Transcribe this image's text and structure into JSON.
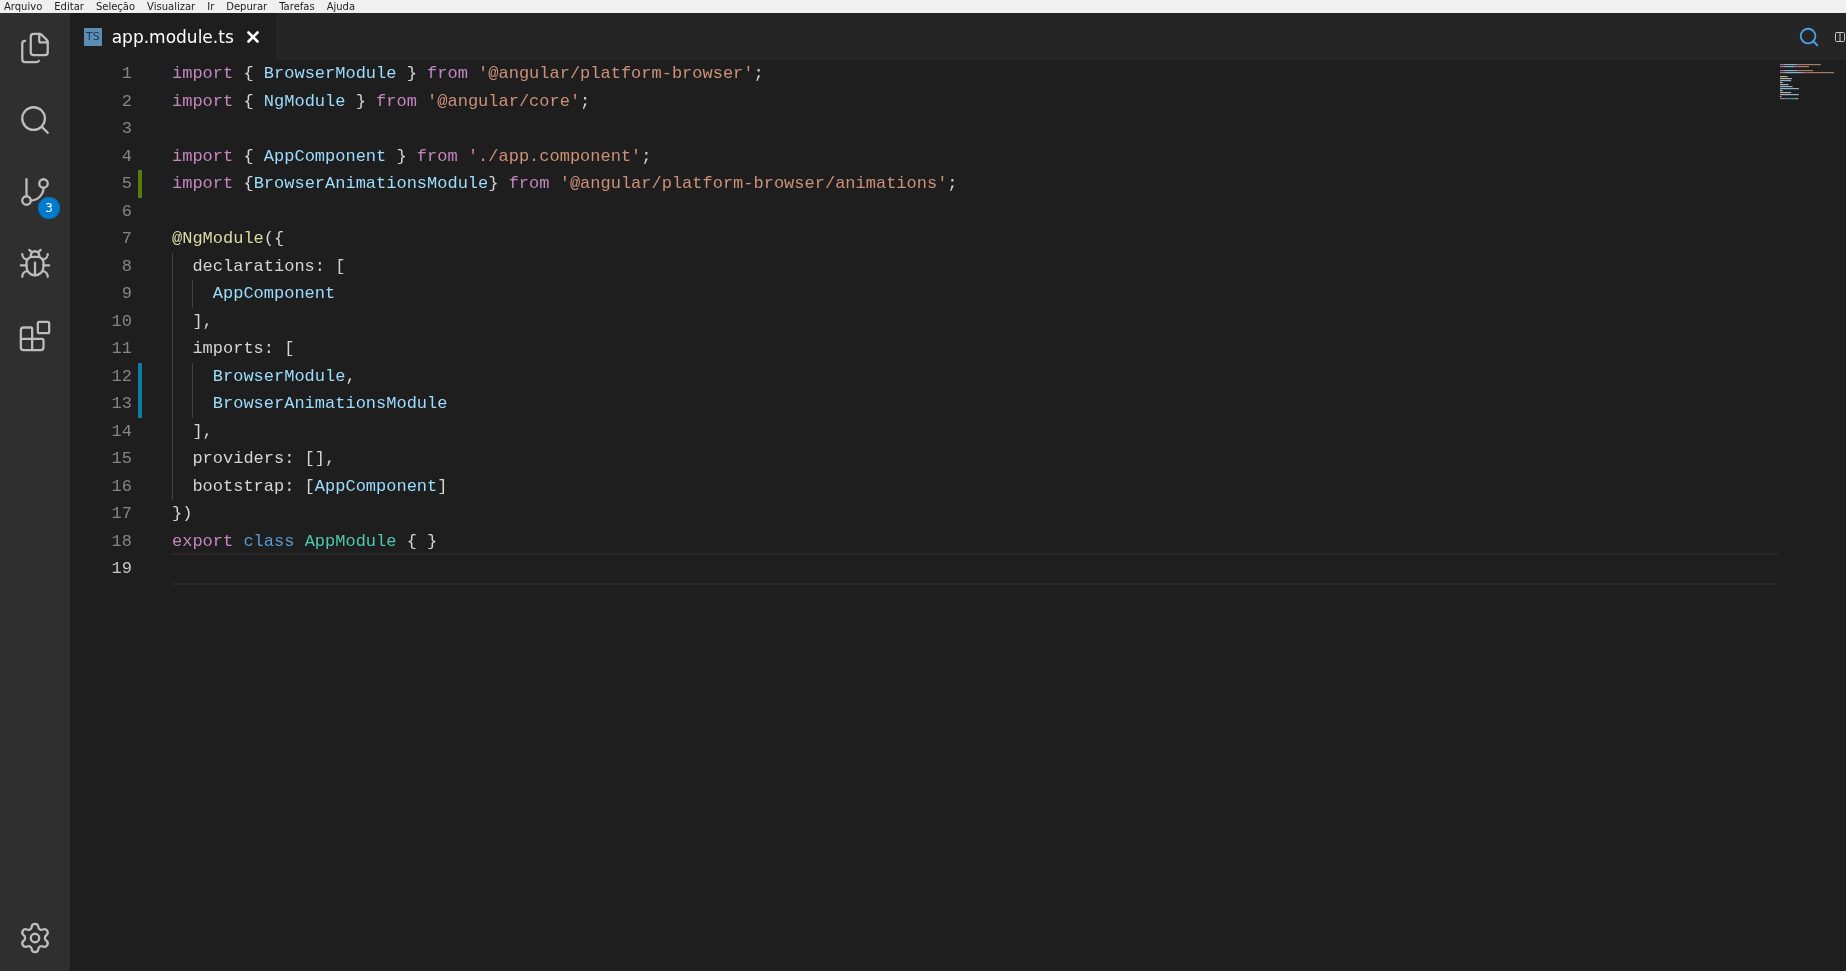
{
  "menu": [
    "Arquivo",
    "Editar",
    "Seleção",
    "Visualizar",
    "Ir",
    "Depurar",
    "Tarefas",
    "Ajuda"
  ],
  "activity_bar": {
    "items": [
      {
        "kind": "files",
        "selected": false
      },
      {
        "kind": "search",
        "selected": false
      },
      {
        "kind": "scm",
        "selected": false,
        "badge": "3"
      },
      {
        "kind": "debug",
        "selected": false
      },
      {
        "kind": "extensions",
        "selected": false
      }
    ],
    "settings": {
      "kind": "settings"
    }
  },
  "tabs": [
    {
      "label": "app.module.ts",
      "icon_text": "TS",
      "selected": true
    }
  ],
  "editor": {
    "lines": [
      {
        "number": "1",
        "added": false,
        "modified": false,
        "current": false,
        "tokens": [
          {
            "kind": "keyword",
            "s": "import"
          },
          {
            "kind": "plain",
            "s": " { "
          },
          {
            "kind": "var",
            "s": "BrowserModule"
          },
          {
            "kind": "plain",
            "s": " } "
          },
          {
            "kind": "keyword",
            "s": "from "
          },
          {
            "kind": "string",
            "s": "'@angular/platform-browser'"
          },
          {
            "kind": "plain",
            "s": ";"
          }
        ]
      },
      {
        "number": "2",
        "added": false,
        "modified": false,
        "current": false,
        "tokens": [
          {
            "kind": "keyword",
            "s": "import"
          },
          {
            "kind": "plain",
            "s": " { "
          },
          {
            "kind": "var",
            "s": "NgModule"
          },
          {
            "kind": "plain",
            "s": " } "
          },
          {
            "kind": "keyword",
            "s": "from "
          },
          {
            "kind": "string",
            "s": "'@angular/core'"
          },
          {
            "kind": "plain",
            "s": ";"
          }
        ]
      },
      {
        "number": "3",
        "added": false,
        "modified": false,
        "current": false
      },
      {
        "number": "4",
        "added": false,
        "modified": false,
        "current": false,
        "tokens": [
          {
            "kind": "keyword",
            "s": "import"
          },
          {
            "kind": "plain",
            "s": " { "
          },
          {
            "kind": "var",
            "s": "AppComponent"
          },
          {
            "kind": "plain",
            "s": " } "
          },
          {
            "kind": "keyword",
            "s": "from "
          },
          {
            "kind": "string",
            "s": "'./app.component'"
          },
          {
            "kind": "plain",
            "s": ";"
          }
        ]
      },
      {
        "number": "5",
        "added": true,
        "modified": false,
        "current": false,
        "tokens": [
          {
            "kind": "keyword",
            "s": "import"
          },
          {
            "kind": "plain",
            "s": " {"
          },
          {
            "kind": "var",
            "s": "BrowserAnimationsModule"
          },
          {
            "kind": "plain",
            "s": "} "
          },
          {
            "kind": "keyword",
            "s": "from "
          },
          {
            "kind": "string",
            "s": "'@angular/platform-browser/animations'"
          },
          {
            "kind": "plain",
            "s": ";"
          }
        ]
      },
      {
        "number": "6",
        "added": false,
        "modified": false,
        "current": false
      },
      {
        "number": "7",
        "added": false,
        "modified": false,
        "current": false,
        "tokens": [
          {
            "kind": "decorator",
            "s": "@NgModule"
          },
          {
            "kind": "plain",
            "s": "({"
          }
        ]
      },
      {
        "number": "8",
        "added": false,
        "modified": false,
        "current": false,
        "tokens": [
          {
            "kind": "plain",
            "s": "  declarations: ["
          }
        ]
      },
      {
        "number": "9",
        "added": false,
        "modified": false,
        "current": false,
        "tokens": [
          {
            "kind": "var",
            "s": "    AppComponent"
          }
        ]
      },
      {
        "number": "10",
        "added": false,
        "modified": false,
        "current": false,
        "tokens": [
          {
            "kind": "plain",
            "s": "  ],"
          }
        ]
      },
      {
        "number": "11",
        "added": false,
        "modified": false,
        "current": false,
        "tokens": [
          {
            "kind": "plain",
            "s": "  imports: ["
          }
        ]
      },
      {
        "number": "12",
        "added": false,
        "modified": true,
        "current": false,
        "tokens": [
          {
            "kind": "var",
            "s": "    BrowserModule"
          },
          {
            "kind": "plain",
            "s": ","
          }
        ]
      },
      {
        "number": "13",
        "added": false,
        "modified": true,
        "current": false,
        "tokens": [
          {
            "kind": "var",
            "s": "    BrowserAnimationsModule"
          }
        ]
      },
      {
        "number": "14",
        "added": false,
        "modified": false,
        "current": false,
        "tokens": [
          {
            "kind": "plain",
            "s": "  ],"
          }
        ]
      },
      {
        "number": "15",
        "added": false,
        "modified": false,
        "current": false,
        "tokens": [
          {
            "kind": "plain",
            "s": "  providers: [],"
          }
        ]
      },
      {
        "number": "16",
        "added": false,
        "modified": false,
        "current": false,
        "tokens": [
          {
            "kind": "plain",
            "s": "  bootstrap: ["
          },
          {
            "kind": "var",
            "s": "AppComponent"
          },
          {
            "kind": "plain",
            "s": "]"
          }
        ]
      },
      {
        "number": "17",
        "added": false,
        "modified": false,
        "current": false,
        "tokens": [
          {
            "kind": "plain",
            "s": "})"
          }
        ]
      },
      {
        "number": "18",
        "added": false,
        "modified": false,
        "current": false,
        "tokens": [
          {
            "kind": "keyword",
            "s": "export "
          },
          {
            "kind": "storage",
            "s": "class "
          },
          {
            "kind": "type",
            "s": "AppModule"
          },
          {
            "kind": "plain",
            "s": " { }"
          }
        ]
      },
      {
        "number": "19",
        "added": false,
        "modified": false,
        "current": true
      }
    ]
  }
}
